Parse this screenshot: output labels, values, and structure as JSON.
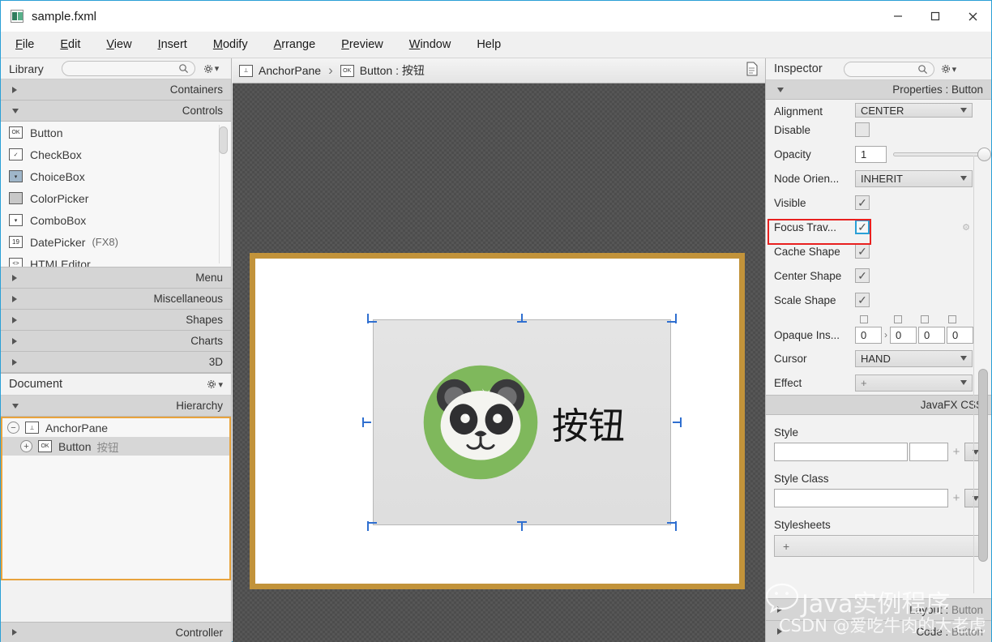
{
  "window": {
    "title": "sample.fxml",
    "icon": "fxml-file-icon",
    "controls": [
      {
        "name": "minimize",
        "glyph": "minimize-icon"
      },
      {
        "name": "maximize",
        "glyph": "maximize-icon"
      },
      {
        "name": "close",
        "glyph": "close-icon"
      }
    ]
  },
  "menubar": {
    "items": [
      {
        "mnemonic": "F",
        "rest": "ile"
      },
      {
        "mnemonic": "E",
        "rest": "dit"
      },
      {
        "mnemonic": "V",
        "rest": "iew"
      },
      {
        "mnemonic": "I",
        "rest": "nsert"
      },
      {
        "mnemonic": "M",
        "rest": "odify"
      },
      {
        "mnemonic": "A",
        "rest": "rrange"
      },
      {
        "mnemonic": "P",
        "rest": "review"
      },
      {
        "mnemonic": "W",
        "rest": "indow"
      },
      {
        "mnemonic": "",
        "rest": "Help"
      }
    ]
  },
  "library": {
    "title": "Library",
    "search_placeholder": "",
    "search_value": "",
    "sections_top": [
      {
        "label": "Containers",
        "expanded": false
      },
      {
        "label": "Controls",
        "expanded": true
      }
    ],
    "controls": [
      {
        "label": "Button",
        "suffix": "",
        "icon": "ok-button-icon"
      },
      {
        "label": "CheckBox",
        "suffix": "",
        "icon": "checkbox-icon"
      },
      {
        "label": "ChoiceBox",
        "suffix": "",
        "icon": "choicebox-icon"
      },
      {
        "label": "ColorPicker",
        "suffix": "",
        "icon": "colorpicker-icon"
      },
      {
        "label": "ComboBox",
        "suffix": "",
        "icon": "combobox-icon"
      },
      {
        "label": "DatePicker",
        "suffix": "(FX8)",
        "icon": "datepicker-icon"
      },
      {
        "label": "HTMLEditor",
        "suffix": "",
        "icon": "htmleditor-icon"
      }
    ],
    "sections_bottom": [
      {
        "label": "Menu",
        "expanded": false
      },
      {
        "label": "Miscellaneous",
        "expanded": false
      },
      {
        "label": "Shapes",
        "expanded": false
      },
      {
        "label": "Charts",
        "expanded": false
      },
      {
        "label": "3D",
        "expanded": false
      }
    ]
  },
  "document": {
    "title": "Document",
    "hierarchy_label": "Hierarchy",
    "controller_label": "Controller",
    "tree": [
      {
        "name": "AnchorPane",
        "chinese": "",
        "icon": "anchorpane-icon",
        "expander": "minus",
        "selected": true
      },
      {
        "name": "Button",
        "chinese": "按钮",
        "icon": "ok-button-icon",
        "expander": "plus",
        "selected": false
      }
    ]
  },
  "breadcrumb": {
    "items": [
      {
        "label": "AnchorPane",
        "icon": "anchorpane-icon"
      },
      {
        "label": "Button : 按钮",
        "icon": "ok-button-icon"
      }
    ],
    "separator": "›",
    "right_icon": "document-icon"
  },
  "canvas": {
    "anchorpane_border_color": "#c2933a",
    "background_color": "#4d4d4d",
    "button": {
      "label": "按钮",
      "icon": "panda-icon",
      "selected": true,
      "colors": {
        "circle": "#7fb85c",
        "ear_outer": "#3a3a3c",
        "ear_inner": "#6e6e70",
        "face": "#f4f4f0",
        "patch": "#2f2f31"
      }
    }
  },
  "inspector": {
    "title": "Inspector",
    "search_value": "",
    "properties_header": "Properties : Button",
    "rows": [
      {
        "name": "alignment",
        "label": "Alignment",
        "type": "combo",
        "value": "CENTER"
      },
      {
        "name": "disable",
        "label": "Disable",
        "type": "checkbox",
        "checked": false
      },
      {
        "name": "opacity",
        "label": "Opacity",
        "type": "slider",
        "value": "1"
      },
      {
        "name": "node-orientation",
        "label": "Node Orien...",
        "type": "combo",
        "value": "INHERIT"
      },
      {
        "name": "visible",
        "label": "Visible",
        "type": "checkbox",
        "checked": true
      },
      {
        "name": "focus-traversable",
        "label": "Focus Trav...",
        "type": "checkbox",
        "checked": true,
        "focused": true
      },
      {
        "name": "cache-shape",
        "label": "Cache Shape",
        "type": "checkbox",
        "checked": true
      },
      {
        "name": "center-shape",
        "label": "Center Shape",
        "type": "checkbox",
        "checked": true
      },
      {
        "name": "scale-shape",
        "label": "Scale Shape",
        "type": "checkbox",
        "checked": true
      },
      {
        "name": "opaque-insets",
        "label": "Opaque Ins...",
        "type": "insets",
        "values": [
          "0",
          "0",
          "0",
          "0"
        ]
      },
      {
        "name": "cursor",
        "label": "Cursor",
        "type": "combo",
        "value": "HAND"
      },
      {
        "name": "effect",
        "label": "Effect",
        "type": "combo",
        "value": "+"
      }
    ],
    "css": {
      "header": "JavaFX CSS",
      "style_label": "Style",
      "style_value": "",
      "style_extra_value": "",
      "style_class_label": "Style Class",
      "style_class_value": "",
      "stylesheets_label": "Stylesheets",
      "stylesheets_add": "+"
    },
    "bottom_sections": [
      {
        "label": "Layout : ",
        "target": "Button"
      },
      {
        "label": "Code : ",
        "target": "Button"
      }
    ],
    "focus_highlight_color": "#e8201f"
  },
  "watermark": {
    "line1": "Java实例程序",
    "line2": "CSDN @爱吃牛肉的大老虎",
    "icon": "wechat-icon"
  }
}
